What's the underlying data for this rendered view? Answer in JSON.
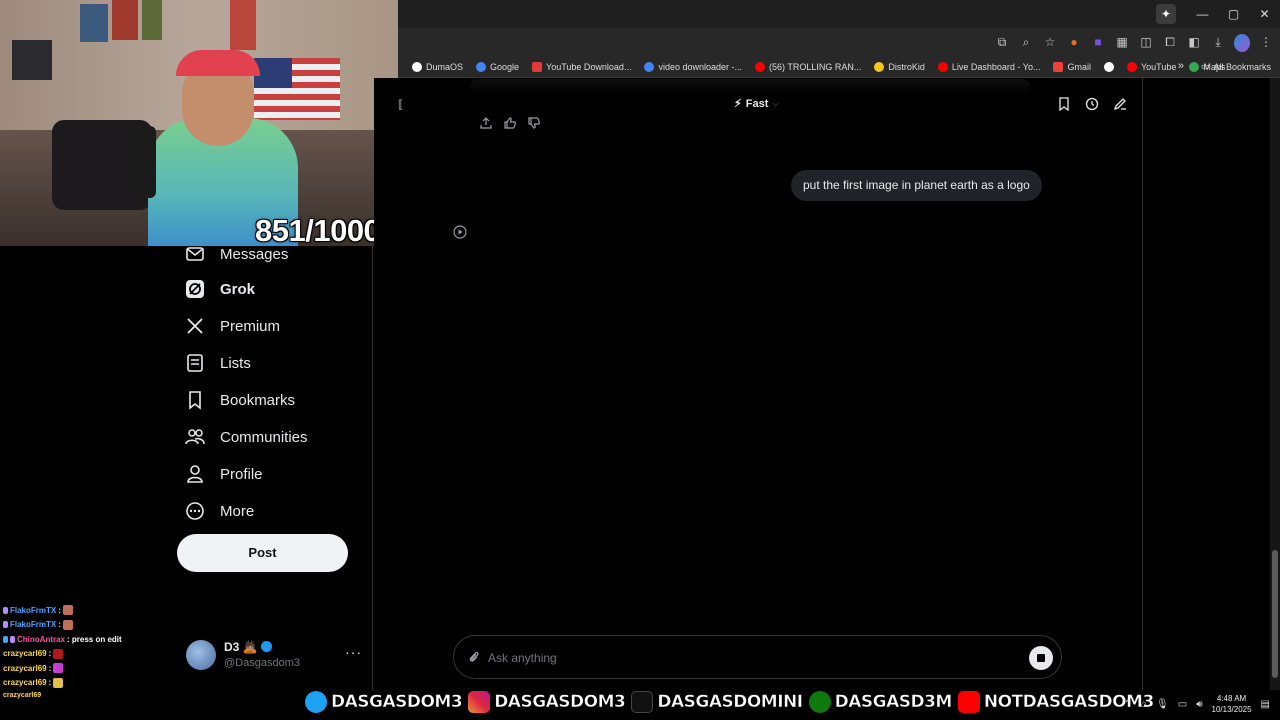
{
  "browser": {
    "window_controls": [
      "—",
      "▢",
      "✕"
    ],
    "bookmarks": [
      {
        "label": "DumaOS",
        "color": "#ffffff"
      },
      {
        "label": "Google",
        "color": "#4285f4"
      },
      {
        "label": "YouTube Download...",
        "color": "#e53935"
      },
      {
        "label": "video downloader -...",
        "color": "#4285f4"
      },
      {
        "label": "(56) TROLLING RAN...",
        "color": "#ff0000"
      },
      {
        "label": "DistroKid",
        "color": "#f5c518"
      },
      {
        "label": "Live Dashboard - Yo...",
        "color": "#ff0000"
      },
      {
        "label": "Gmail",
        "color": "#ea4335"
      },
      {
        "label": "",
        "color": "#ffffff"
      },
      {
        "label": "YouTube",
        "color": "#ff0000"
      },
      {
        "label": "Maps",
        "color": "#34a853"
      }
    ],
    "more_bookmarks": "»",
    "all_bookmarks": "All Bookmarks"
  },
  "stream": {
    "counter": "851/1000",
    "chat": [
      {
        "user": "FlakoFrmTX",
        "color": "#4aa3ff",
        "message": ":",
        "emote": true
      },
      {
        "user": "FlakoFrmTX",
        "color": "#4aa3ff",
        "message": ":",
        "emote": true
      },
      {
        "user": "ChinoAntrax",
        "color": "#ff4fa3",
        "message": ": press on edit",
        "emote": false
      },
      {
        "user": "crazycarl69",
        "color": "#ffd54a",
        "message": ":",
        "emote": true
      },
      {
        "user": "crazycarl69",
        "color": "#ffd54a",
        "message": ":",
        "emote": true
      },
      {
        "user": "crazycarl69",
        "color": "#ffd54a",
        "message": ":",
        "emote": true
      }
    ],
    "socials": [
      {
        "handle": "DASGASDOM3",
        "icon": "twitter-icon"
      },
      {
        "handle": "DASGASDOM3",
        "icon": "instagram-icon"
      },
      {
        "handle": "DASGASDOMINI",
        "icon": "tiktok-icon"
      },
      {
        "handle": "DASGASD3M",
        "icon": "xbox-icon"
      },
      {
        "handle": "NOTDASGASDOM3",
        "icon": "youtube-icon"
      }
    ]
  },
  "nav": {
    "items": [
      {
        "label": "Messages",
        "icon": "mail-icon",
        "active": false
      },
      {
        "label": "Grok",
        "icon": "grok-icon",
        "active": true
      },
      {
        "label": "Premium",
        "icon": "x-icon",
        "active": false
      },
      {
        "label": "Lists",
        "icon": "list-icon",
        "active": false
      },
      {
        "label": "Bookmarks",
        "icon": "bookmark-icon",
        "active": false
      },
      {
        "label": "Communities",
        "icon": "people-icon",
        "active": false
      },
      {
        "label": "Profile",
        "icon": "person-icon",
        "active": false
      },
      {
        "label": "More",
        "icon": "more-circle-icon",
        "active": false
      }
    ],
    "post_label": "Post",
    "account": {
      "name": "D3",
      "handle": "@Dasgasdom3",
      "more": "···"
    }
  },
  "grok": {
    "mode_label": "Fast",
    "user_message": "put the first image in planet earth as a logo",
    "input_placeholder": "Ask anything"
  },
  "taskbar": {
    "time": "4:48 AM",
    "date": "10/13/2025"
  },
  "colors": {
    "accent": "#1d9bf0",
    "background": "#000000",
    "post_button": "#eff3f4"
  }
}
